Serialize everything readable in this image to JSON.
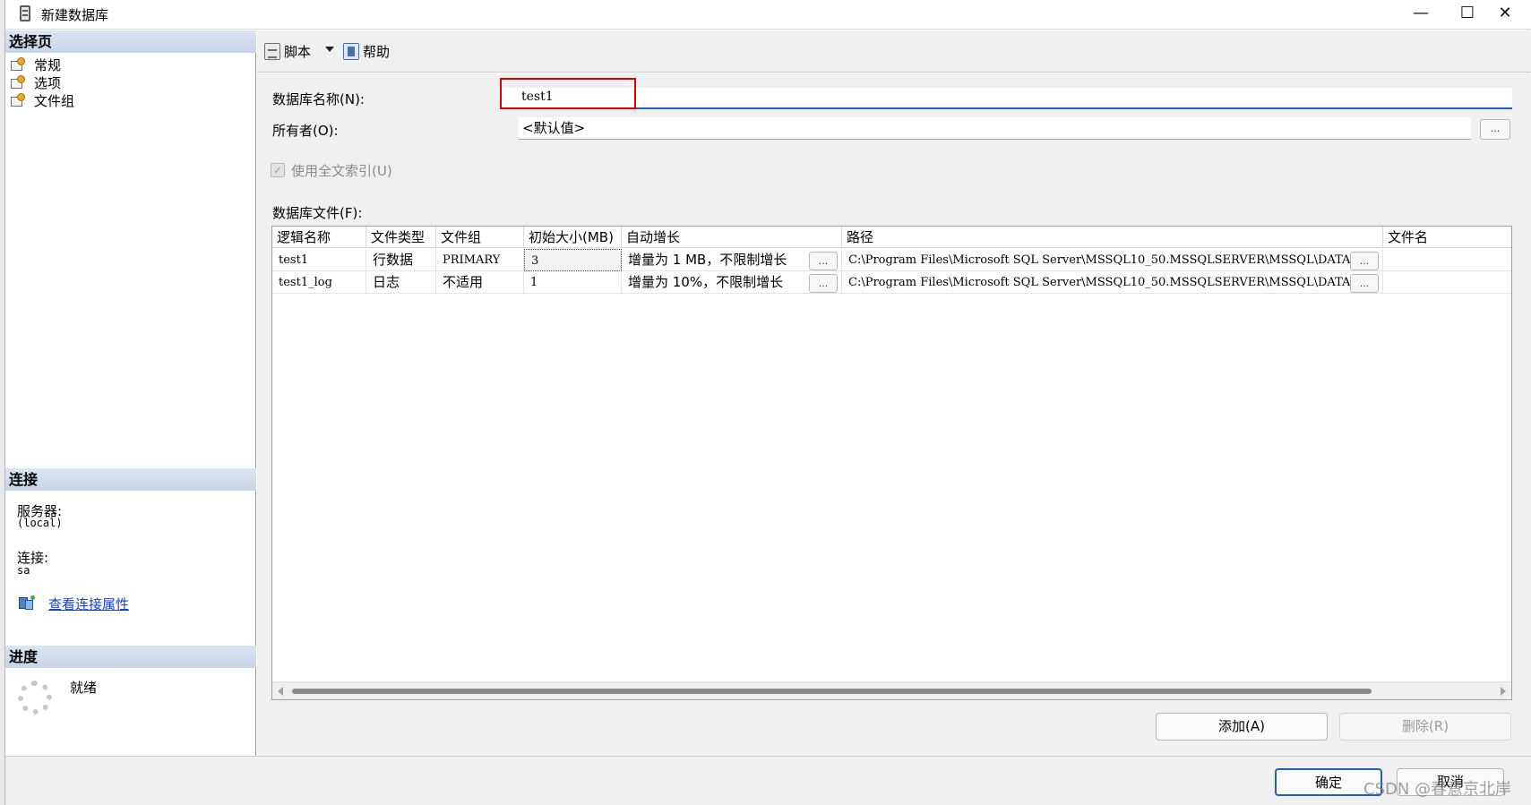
{
  "window": {
    "title": "新建数据库",
    "minimize_glyph": "—",
    "maximize_glyph": "☐",
    "close_glyph": "✕"
  },
  "left_panel": {
    "select_page_header": "选择页",
    "pages": [
      {
        "label": "常规",
        "icon": "page-settings-icon"
      },
      {
        "label": "选项",
        "icon": "page-settings-icon"
      },
      {
        "label": "文件组",
        "icon": "page-settings-icon"
      }
    ],
    "connection_header": "连接",
    "server_label": "服务器:",
    "server_value": "(local)",
    "connection_label": "连接:",
    "connection_value": "sa",
    "view_connection_link": "查看连接属性",
    "progress_header": "进度",
    "progress_status": "就绪"
  },
  "toolbar": {
    "script_label": "脚本",
    "help_label": "帮助"
  },
  "form": {
    "db_name_label": "数据库名称(N):",
    "db_name_value": "test1",
    "owner_label": "所有者(O):",
    "owner_value": "<默认值>",
    "browse_button": "...",
    "fulltext_label": "使用全文索引(U)",
    "fulltext_checked": true,
    "files_label": "数据库文件(F):"
  },
  "grid": {
    "columns": [
      "逻辑名称",
      "文件类型",
      "文件组",
      "初始大小(MB)",
      "自动增长",
      "路径",
      "文件名"
    ],
    "rows": [
      {
        "logical_name": "test1",
        "file_type": "行数据",
        "filegroup": "PRIMARY",
        "initial_size": "3",
        "autogrowth": "增量为 1 MB，不限制增长",
        "path": "C:\\Program Files\\Microsoft SQL Server\\MSSQL10_50.MSSQLSERVER\\MSSQL\\DATA",
        "file_name": ""
      },
      {
        "logical_name": "test1_log",
        "file_type": "日志",
        "filegroup": "不适用",
        "initial_size": "1",
        "autogrowth": "增量为 10%，不限制增长",
        "path": "C:\\Program Files\\Microsoft SQL Server\\MSSQL10_50.MSSQLSERVER\\MSSQL\\DATA",
        "file_name": ""
      }
    ],
    "cell_button": "..."
  },
  "actions": {
    "add_label": "添加(A)",
    "remove_label": "删除(R)",
    "ok_label": "确定",
    "cancel_label": "取消"
  },
  "watermark": "CSDN @春意京北岸",
  "colors": {
    "highlight_box": "#e00000",
    "link": "#1140d8",
    "header_band": "#c6d5e8"
  }
}
